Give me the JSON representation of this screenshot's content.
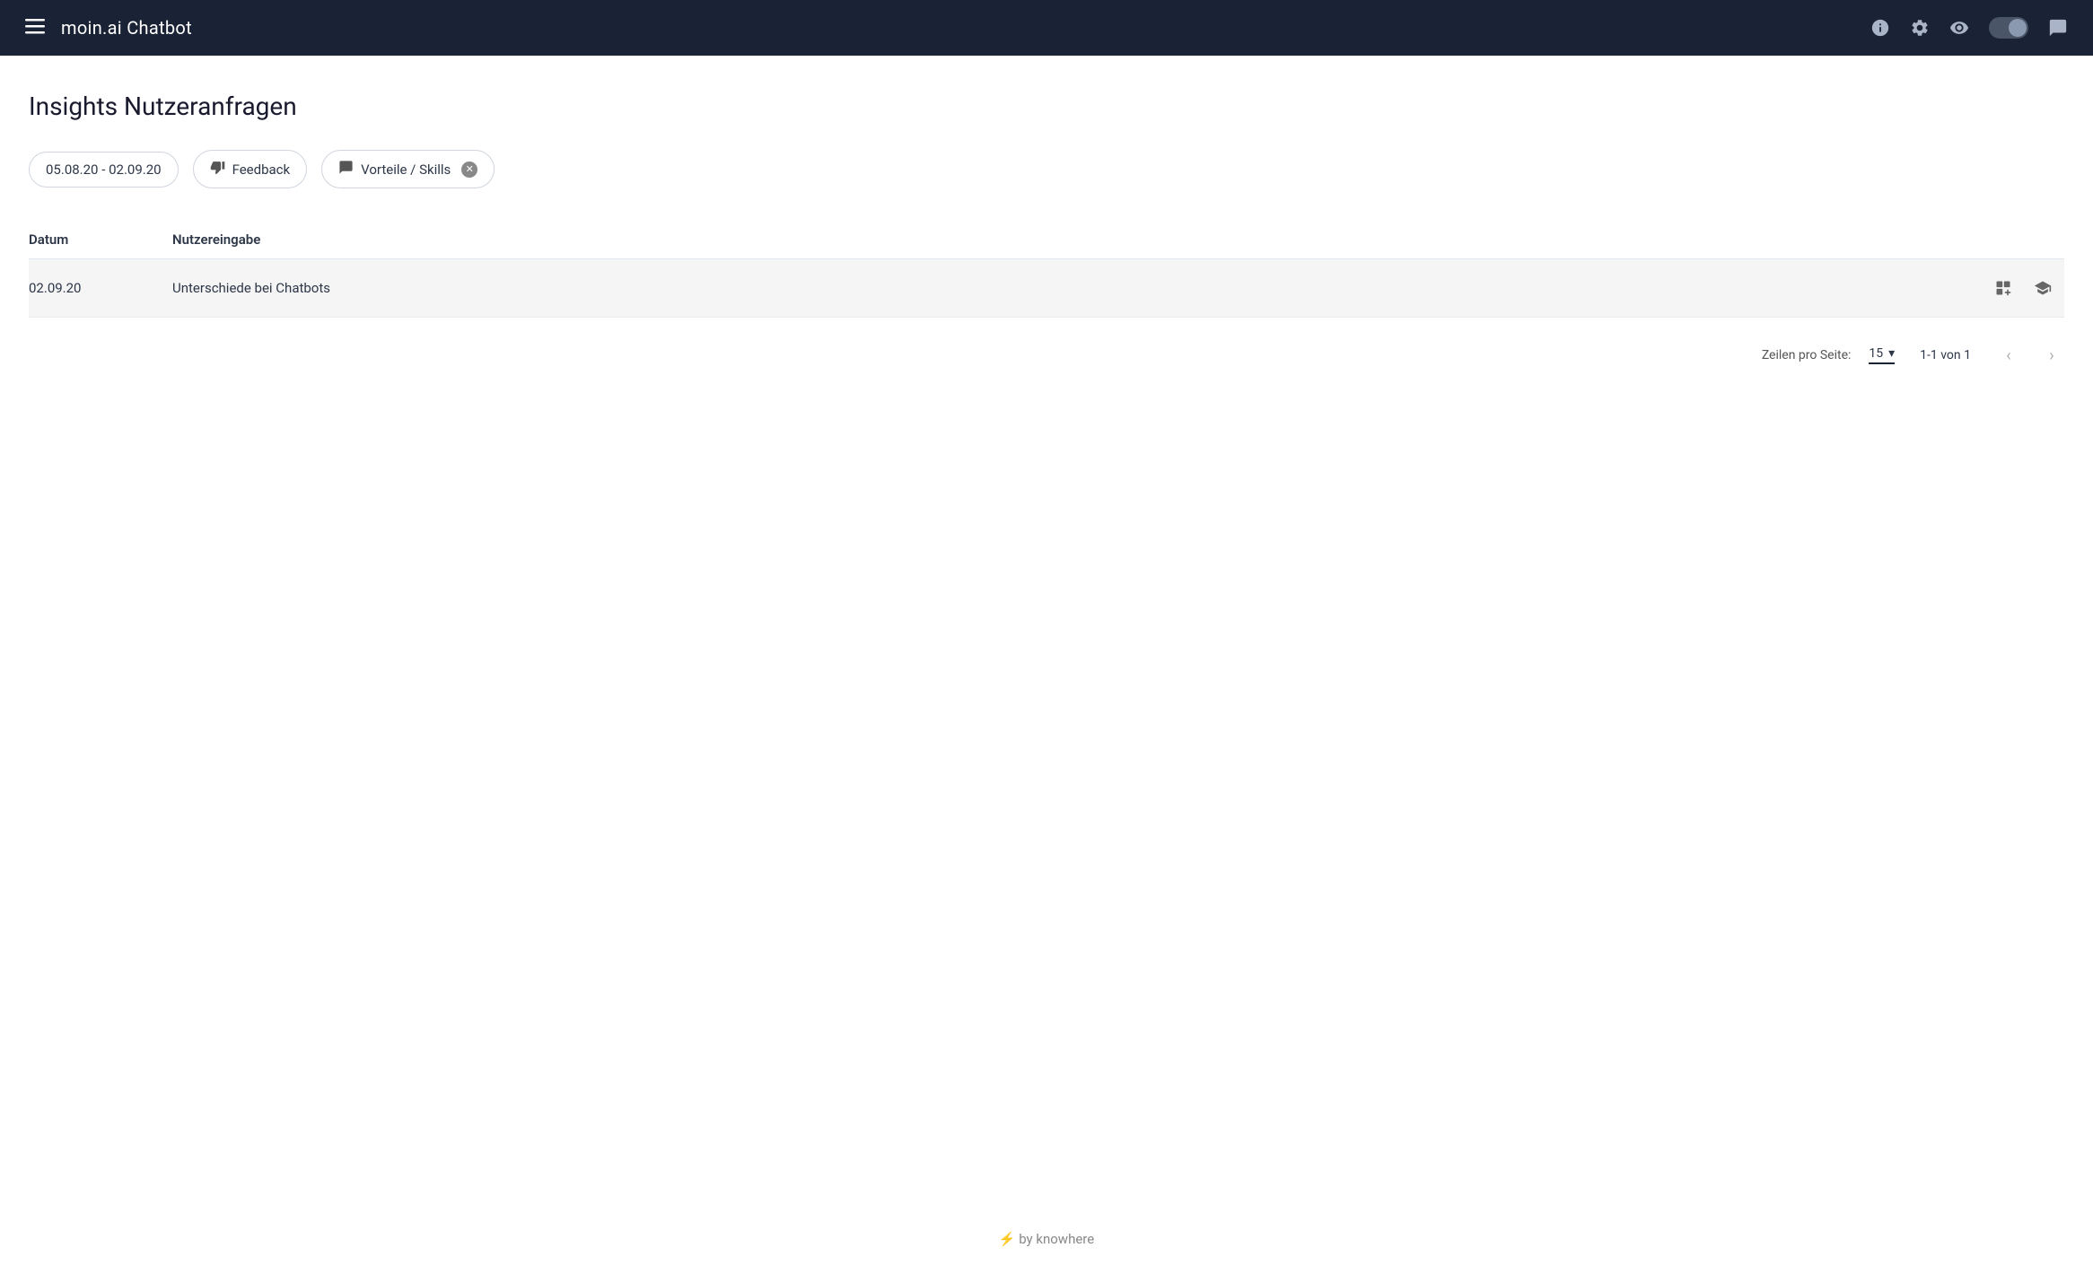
{
  "navbar": {
    "brand": "moin.ai Chatbot",
    "icons": {
      "menu": "menu-icon",
      "info": "info-icon",
      "settings": "settings-icon",
      "preview": "eye-icon",
      "chat": "chat-icon"
    }
  },
  "page": {
    "title": "Insights Nutzeranfragen"
  },
  "filters": [
    {
      "id": "date-range",
      "label": "05.08.20 - 02.09.20",
      "icon": null,
      "closeable": false
    },
    {
      "id": "feedback",
      "label": "Feedback",
      "icon": "thumbs-down",
      "closeable": false
    },
    {
      "id": "vorteile-skills",
      "label": "Vorteile / Skills",
      "icon": "chat-bubble",
      "closeable": true
    }
  ],
  "table": {
    "columns": [
      {
        "id": "datum",
        "label": "Datum"
      },
      {
        "id": "nutzereingabe",
        "label": "Nutzereingabe"
      }
    ],
    "rows": [
      {
        "datum": "02.09.20",
        "nutzereingabe": "Unterschiede bei Chatbots"
      }
    ]
  },
  "pagination": {
    "zeilen_label": "Zeilen pro Seite:",
    "per_page": "15",
    "page_info": "1-1 von 1"
  },
  "footer": {
    "text": "by knowhere",
    "lightning": "⚡"
  }
}
